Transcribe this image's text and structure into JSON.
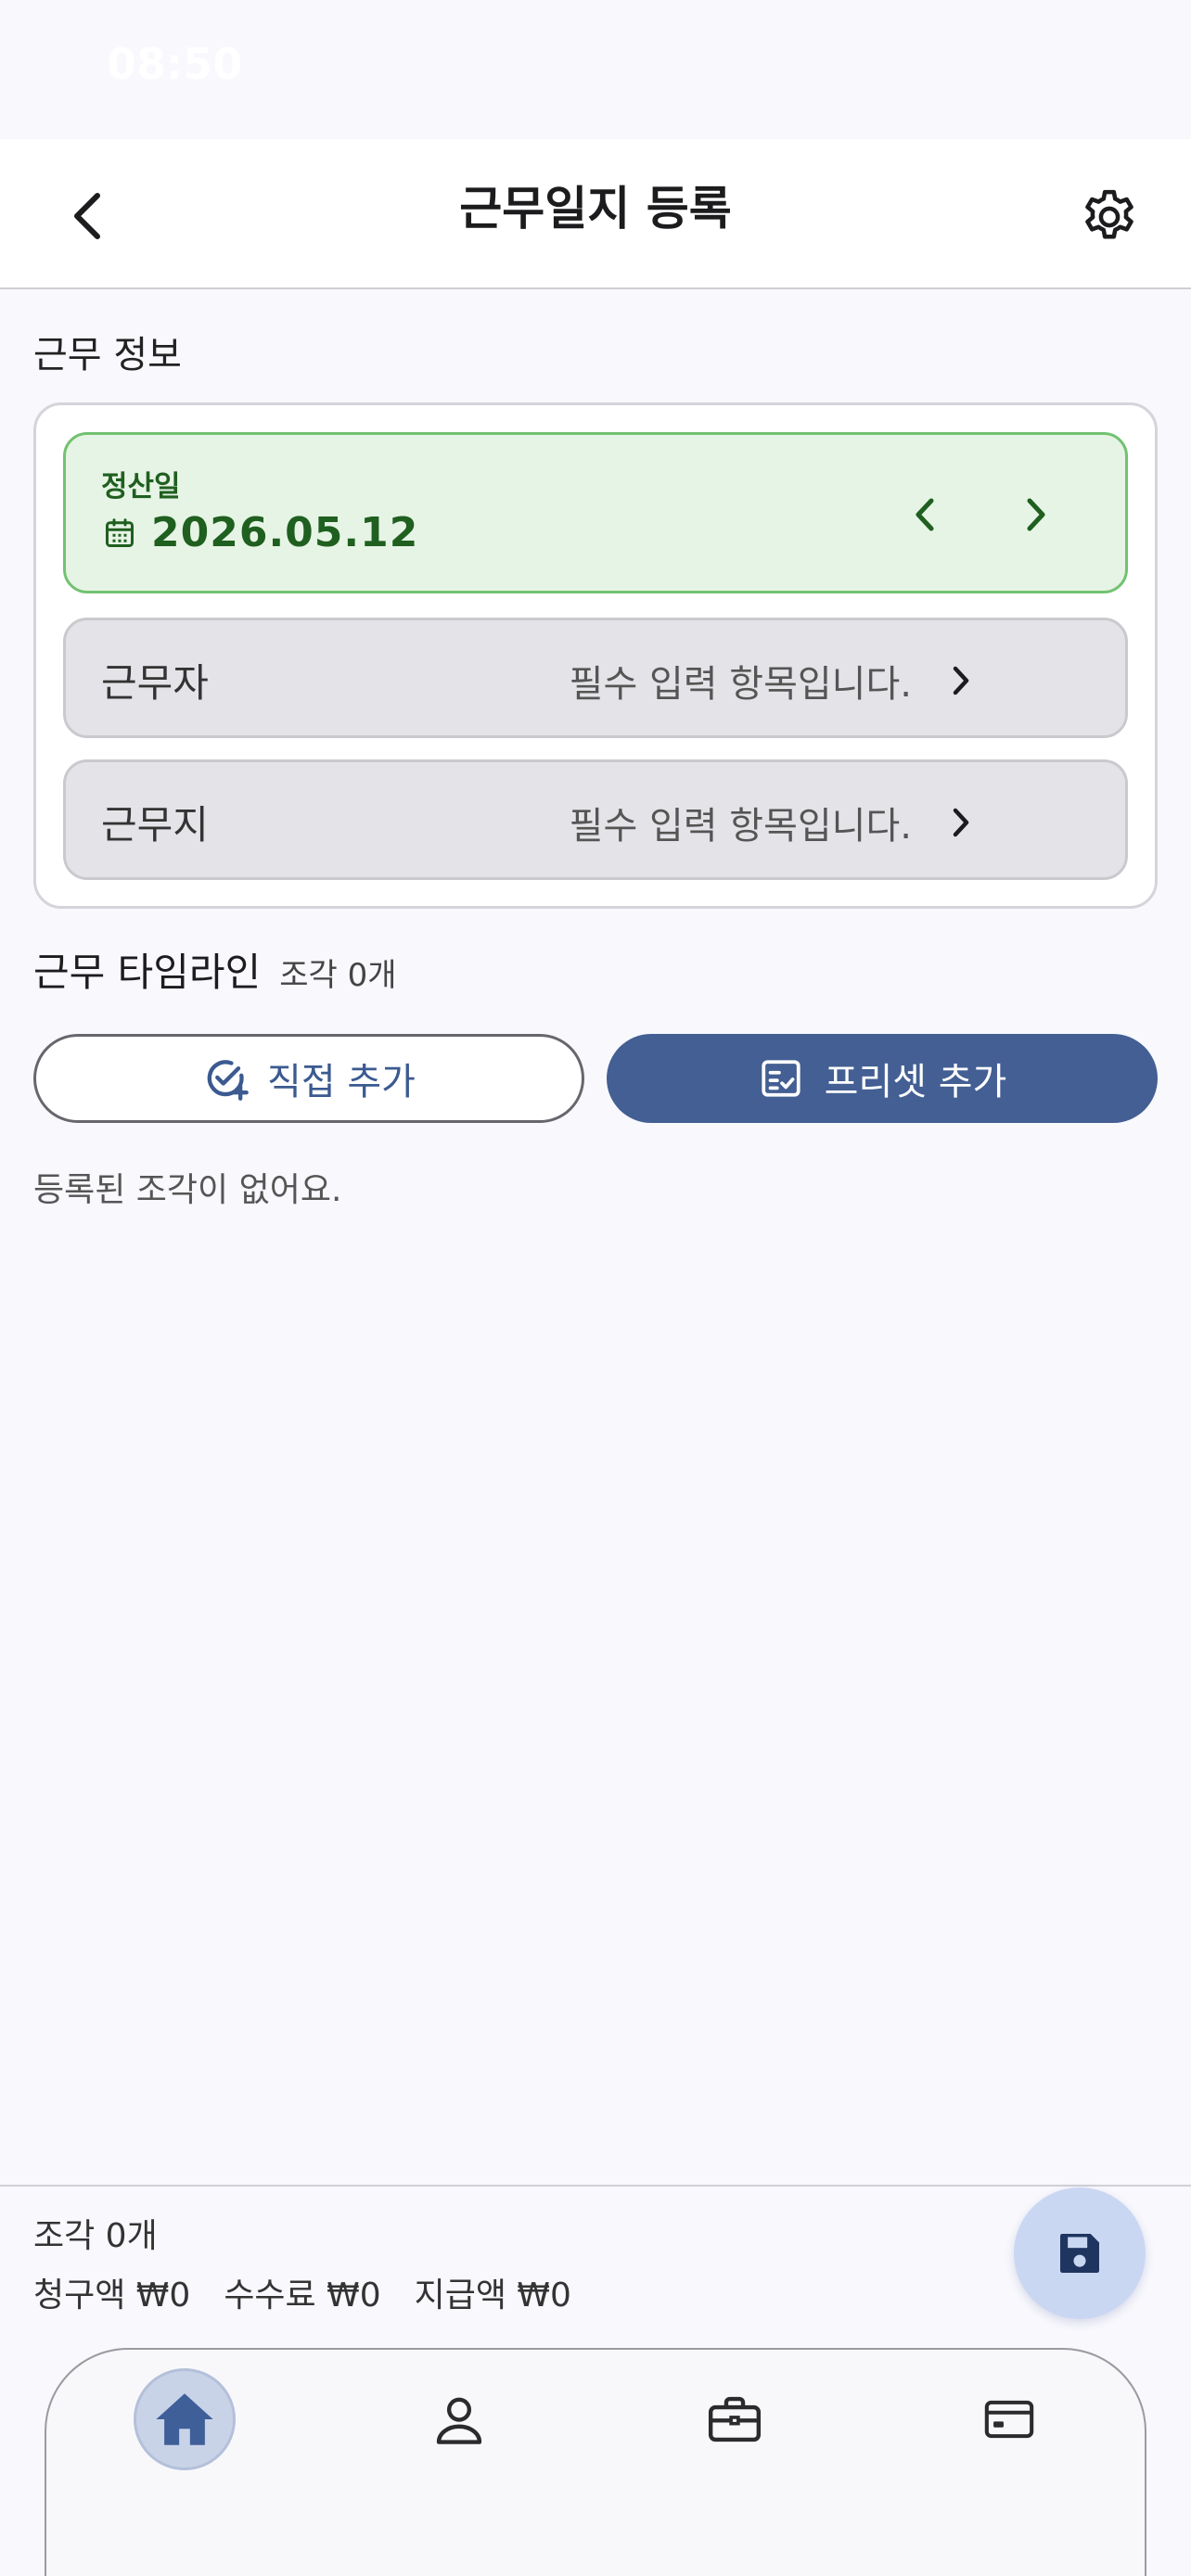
{
  "status_bar": {
    "time": "08:50"
  },
  "header": {
    "title": "근무일지 등록",
    "back_icon": "chevron-left-icon",
    "settings_icon": "gear-icon"
  },
  "info_section": {
    "title": "근무 정보",
    "settlement": {
      "label": "정산일",
      "date": "2026.05.12",
      "icon": "calendar-icon"
    },
    "fields": [
      {
        "label": "근무자",
        "value": "필수 입력 항목입니다."
      },
      {
        "label": "근무지",
        "value": "필수 입력 항목입니다."
      }
    ]
  },
  "timeline": {
    "title": "근무 타임라인",
    "count": "조각 0개",
    "direct_add_label": "직접 추가",
    "preset_add_label": "프리셋 추가",
    "empty_message": "등록된 조각이 없어요."
  },
  "summary": {
    "count": "조각 0개",
    "billing": "청구액 ₩0",
    "fee": "수수료 ₩0",
    "payout": "지급액 ₩0"
  },
  "colors": {
    "accent": "#435f93",
    "settle_bg": "#e6f4e5",
    "settle_text": "#1f5f1f"
  },
  "bottom_nav": {
    "items": [
      {
        "icon": "home-icon",
        "active": true
      },
      {
        "icon": "person-icon",
        "active": false
      },
      {
        "icon": "briefcase-icon",
        "active": false
      },
      {
        "icon": "credit-card-icon",
        "active": false
      }
    ]
  }
}
